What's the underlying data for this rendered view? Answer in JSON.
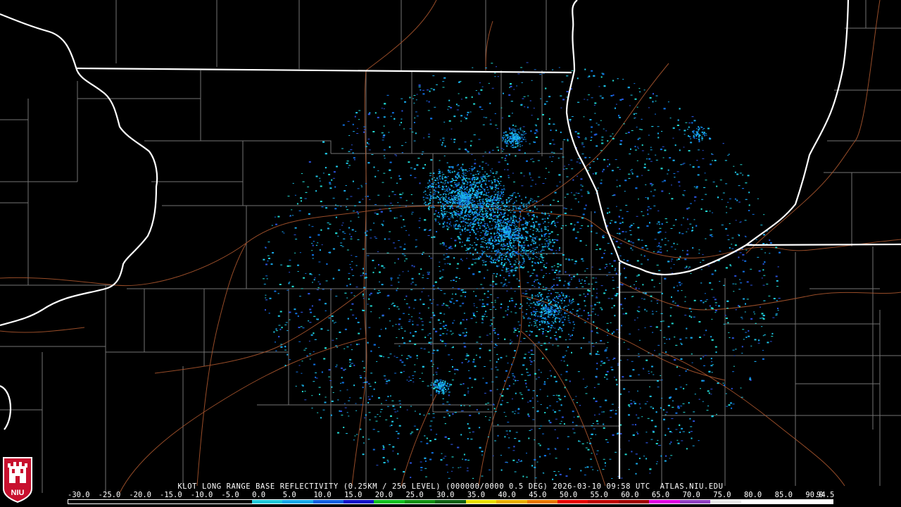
{
  "product": {
    "caption": "KLOT LONG RANGE BASE REFLECTIVITY (0.25KM / 256 LEVEL) (000000/0000 0.5 DEG) 2026-03-10 09:58 UTC  ATLAS.NIU.EDU",
    "radar_site": "KLOT",
    "elevation_deg": 0.5,
    "timestamp_utc": "2026-03-10 09:58 UTC",
    "source": "ATLAS.NIU.EDU"
  },
  "logo": {
    "text": "NIU",
    "accent": "#c8102e"
  },
  "colorbar": {
    "labels": [
      "-30.0",
      "-25.0",
      "-20.0",
      "-15.0",
      "-10.0",
      "-5.0",
      "0.0",
      "5.0",
      "10.0",
      "15.0",
      "20.0",
      "25.0",
      "30.0",
      "35.0",
      "40.0",
      "45.0",
      "50.0",
      "55.0",
      "60.0",
      "65.0",
      "70.0",
      "75.0",
      "80.0",
      "85.0",
      "90.0",
      "94.5"
    ],
    "colors": [
      "#000000",
      "#000000",
      "#000000",
      "#000000",
      "#000000",
      "#000000",
      "#1ec8d8",
      "#17a8e8",
      "#1060e0",
      "#1010c8",
      "#10c020",
      "#109010",
      "#0c6010",
      "#e8e000",
      "#e8b000",
      "#e87800",
      "#e80000",
      "#c00000",
      "#a00000",
      "#e000e0",
      "#9040c0",
      "#e8e8e8",
      "#ffffff",
      "#ffffff",
      "#ffffff"
    ]
  },
  "map": {
    "state_border_color": "#ffffff",
    "county_line_color": "#9a9a9a",
    "highway_color": "#b25a30",
    "echo_colors": [
      "#1ec8e8",
      "#18a8e8",
      "#1070e0",
      "#2a50d8",
      "#22d8d0"
    ]
  }
}
